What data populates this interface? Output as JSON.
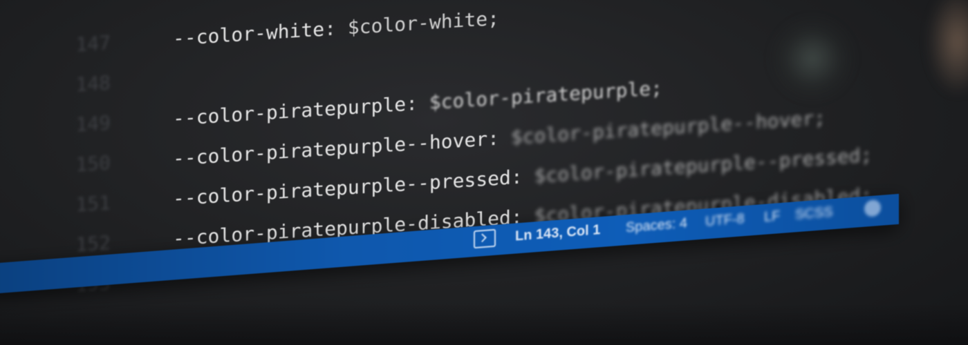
{
  "editor": {
    "lines": [
      {
        "number": "147",
        "prop": "--color-white",
        "value": "$color-white;"
      },
      {
        "number": "148",
        "prop": "",
        "value": ""
      },
      {
        "number": "149",
        "prop": "--color-piratepurple",
        "value": "$color-piratepurple;"
      },
      {
        "number": "150",
        "prop": "--color-piratepurple--hover",
        "value": "$color-piratepurple--hover;"
      },
      {
        "number": "151",
        "prop": "--color-piratepurple--pressed",
        "value": "$color-piratepurple--pressed;"
      },
      {
        "number": "152",
        "prop": "--color-piratepurple-disabled",
        "value": "$color-piratepurple-disabled;"
      },
      {
        "number": "153",
        "prop": "",
        "value": ""
      }
    ],
    "separator": ": "
  },
  "statusbar": {
    "cursor_position": "Ln 143, Col 1",
    "indent": "Spaces: 4",
    "encoding": "UTF-8",
    "eol": "LF",
    "language": "SCSS",
    "icons": [
      "terminal-icon",
      "bell-icon"
    ],
    "background_color": "#0e5db8"
  }
}
